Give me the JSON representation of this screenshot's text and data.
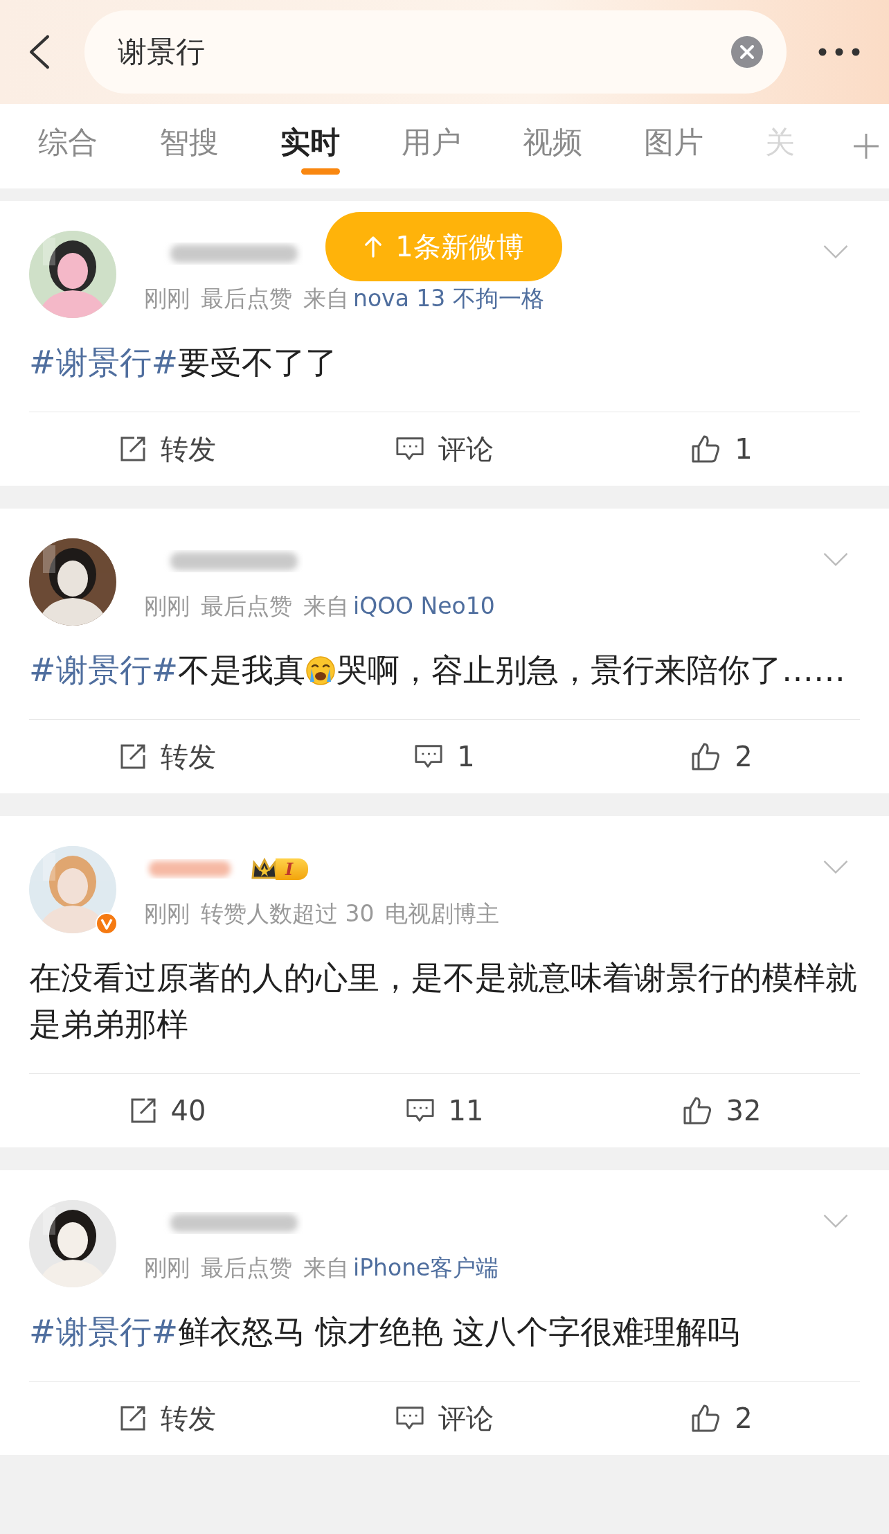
{
  "search": {
    "value": "谢景行"
  },
  "tabs": [
    {
      "label": "综合",
      "selected": false,
      "faded": false
    },
    {
      "label": "智搜",
      "selected": false,
      "faded": false
    },
    {
      "label": "实时",
      "selected": true,
      "faded": false
    },
    {
      "label": "用户",
      "selected": false,
      "faded": false
    },
    {
      "label": "视频",
      "selected": false,
      "faded": false
    },
    {
      "label": "图片",
      "selected": false,
      "faded": false
    },
    {
      "label": "关",
      "selected": false,
      "faded": true
    }
  ],
  "new_posts_notice": "1条新微博",
  "posts": [
    {
      "verified": false,
      "vip": false,
      "meta": [
        {
          "kind": "plain",
          "text": "刚刚"
        },
        {
          "kind": "plain",
          "text": "最后点赞"
        },
        {
          "kind": "source",
          "prefix": "来自",
          "text": "nova 13 不拘一格"
        }
      ],
      "content": [
        {
          "kind": "hashtag",
          "text": "#谢景行#"
        },
        {
          "kind": "text",
          "text": "要受不了了"
        }
      ],
      "actions": [
        {
          "kind": "repost",
          "label": "转发"
        },
        {
          "kind": "comment",
          "label": "评论"
        },
        {
          "kind": "like",
          "label": "1"
        }
      ]
    },
    {
      "verified": false,
      "vip": false,
      "meta": [
        {
          "kind": "plain",
          "text": "刚刚"
        },
        {
          "kind": "plain",
          "text": "最后点赞"
        },
        {
          "kind": "source",
          "prefix": "来自",
          "text": "iQOO Neo10"
        }
      ],
      "content": [
        {
          "kind": "hashtag",
          "text": "#谢景行#"
        },
        {
          "kind": "text",
          "text": "不是我真"
        },
        {
          "kind": "emoji"
        },
        {
          "kind": "text",
          "text": "哭啊，容止别急，景行来陪你了……"
        }
      ],
      "actions": [
        {
          "kind": "repost",
          "label": "转发"
        },
        {
          "kind": "comment",
          "label": "1"
        },
        {
          "kind": "like",
          "label": "2"
        }
      ]
    },
    {
      "verified": true,
      "vip": true,
      "level_badge": "I",
      "meta": [
        {
          "kind": "plain",
          "text": "刚刚"
        },
        {
          "kind": "plain",
          "text": "转赞人数超过 30"
        },
        {
          "kind": "plain",
          "text": "电视剧博主"
        }
      ],
      "content": [
        {
          "kind": "text",
          "text": "在没看过原著的人的心里，是不是就意味着谢景行的模样就是弟弟那样"
        }
      ],
      "actions": [
        {
          "kind": "repost",
          "label": "40"
        },
        {
          "kind": "comment",
          "label": "11"
        },
        {
          "kind": "like",
          "label": "32"
        }
      ]
    },
    {
      "verified": false,
      "vip": false,
      "meta": [
        {
          "kind": "plain",
          "text": "刚刚"
        },
        {
          "kind": "plain",
          "text": "最后点赞"
        },
        {
          "kind": "source",
          "prefix": "来自",
          "text": "iPhone客户端"
        }
      ],
      "content": [
        {
          "kind": "hashtag",
          "text": "#谢景行#"
        },
        {
          "kind": "text",
          "text": "鲜衣怒马 惊才绝艳 这八个字很难理解吗"
        }
      ],
      "actions": [
        {
          "kind": "repost",
          "label": "转发"
        },
        {
          "kind": "comment",
          "label": "评论"
        },
        {
          "kind": "like",
          "label": "2"
        }
      ]
    }
  ]
}
